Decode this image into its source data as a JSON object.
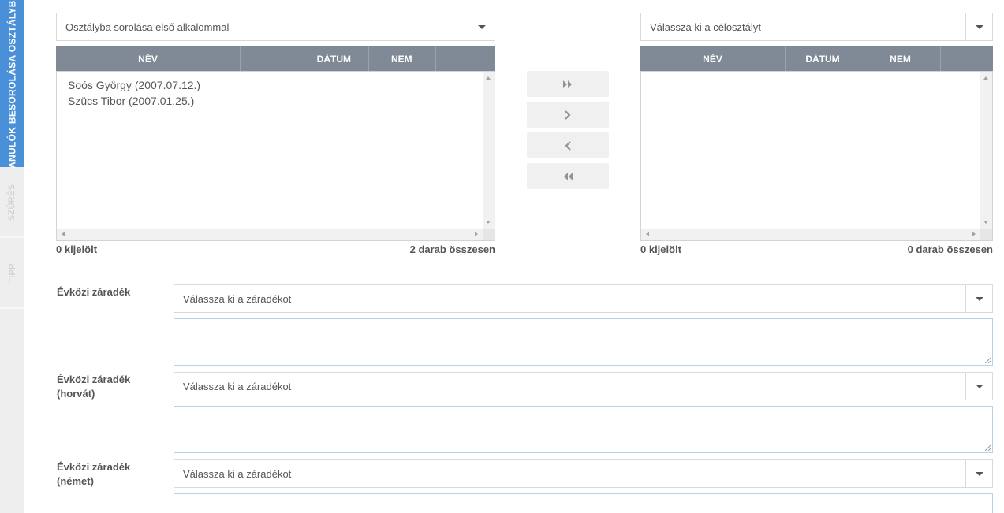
{
  "vertical_tabs": [
    {
      "label": "TANULÓK BESOROLÁSA OSZTÁLYBA",
      "active": true
    },
    {
      "label": "SZŰRÉS",
      "active": false
    },
    {
      "label": "TIPP",
      "active": false
    }
  ],
  "source": {
    "select_value": "Osztályba sorolása első alkalommal",
    "columns": [
      "NÉV",
      "DÁTUM",
      "NEM"
    ],
    "rows": [
      "Soós György (2007.07.12.)",
      "Szücs Tibor (2007.01.25.)"
    ],
    "selected_count": "0 kijelölt",
    "total_count": "2 darab összesen"
  },
  "target": {
    "select_value": "Válassza ki a célosztályt",
    "columns": [
      "NÉV",
      "DÁTUM",
      "NEM"
    ],
    "rows": [],
    "selected_count": "0 kijelölt",
    "total_count": "0 darab összesen"
  },
  "transfer_buttons": [
    {
      "icon": "double-chevron-right-icon"
    },
    {
      "icon": "chevron-right-icon"
    },
    {
      "icon": "chevron-left-icon"
    },
    {
      "icon": "double-chevron-left-icon"
    }
  ],
  "clauses": [
    {
      "label": "Évközi záradék",
      "select_value": "Válassza ki a záradékot",
      "text": ""
    },
    {
      "label": "Évközi záradék (horvát)",
      "select_value": "Válassza ki a záradékot",
      "text": ""
    },
    {
      "label": "Évközi záradék (német)",
      "select_value": "Válassza ki a záradékot",
      "text": ""
    }
  ],
  "colors": {
    "active_tab": "#4a90d9",
    "table_header": "#808a96"
  }
}
